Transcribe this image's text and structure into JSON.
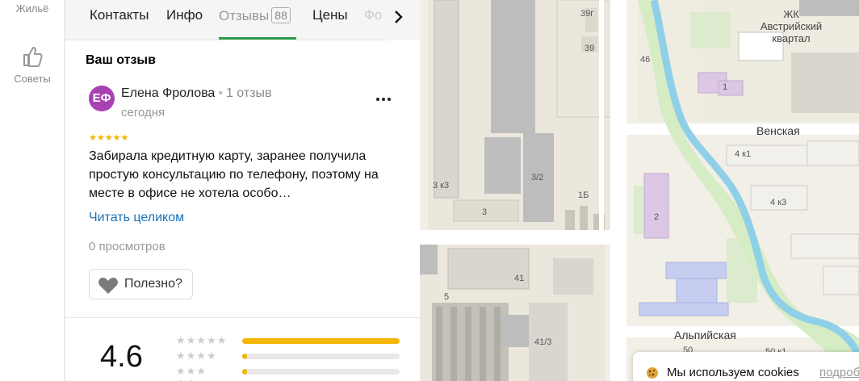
{
  "rail": {
    "top_label": "Жильё",
    "tips_label": "Советы"
  },
  "tabs": {
    "contacts": "Контакты",
    "info": "Инфо",
    "reviews": "Отзывы",
    "reviews_count": "88",
    "prices": "Цены",
    "photos_fragment": "Фо"
  },
  "review": {
    "section_title": "Ваш отзыв",
    "avatar_initials": "ЕФ",
    "author": "Елена Фролова",
    "separator": "•",
    "author_reviews": "1 отзыв",
    "date": "сегодня",
    "stars": "★★★★★",
    "rating_value": 5,
    "text": "Забирала кредитную карту, заранее получила простую консультацию по телефону, поэтому на месте в офисе не хотела особо…",
    "read_more": "Читать целиком",
    "views": "0 просмотров",
    "useful_label": "Полезно?"
  },
  "summary": {
    "rating": "4.6",
    "rows": [
      {
        "stars": "★★★★★",
        "fraction": 1.0
      },
      {
        "stars": "★★★★",
        "fraction": 0.03
      },
      {
        "stars": "★★★",
        "fraction": 0.03
      },
      {
        "stars": "★★",
        "fraction": 0.0
      }
    ]
  },
  "map": {
    "streets": {
      "venskaya": "Венская",
      "alpiyskaya": "Альпийская"
    },
    "poi": {
      "line1": "ЖК",
      "line2": "Австрийский",
      "line3": "квартал"
    },
    "house_numbers": {
      "h39g": "39г",
      "h39": "39",
      "h46": "46",
      "h1": "1",
      "h4k1": "4 к1",
      "h3k3": "3 к3",
      "h32": "3/2",
      "h1b": "1Б",
      "h3": "3",
      "h4k3": "4 к3",
      "h2": "2",
      "h41": "41",
      "h5": "5",
      "h413": "41/3",
      "h50": "50",
      "h50k1": "50 к1"
    }
  },
  "cookie": {
    "text": "Мы используем cookies",
    "link": "подробнее"
  },
  "colors": {
    "accent_green": "#2c9c46",
    "link_blue": "#1a73b8",
    "star_yellow": "#f5b400",
    "avatar_purple": "#a842b3"
  }
}
